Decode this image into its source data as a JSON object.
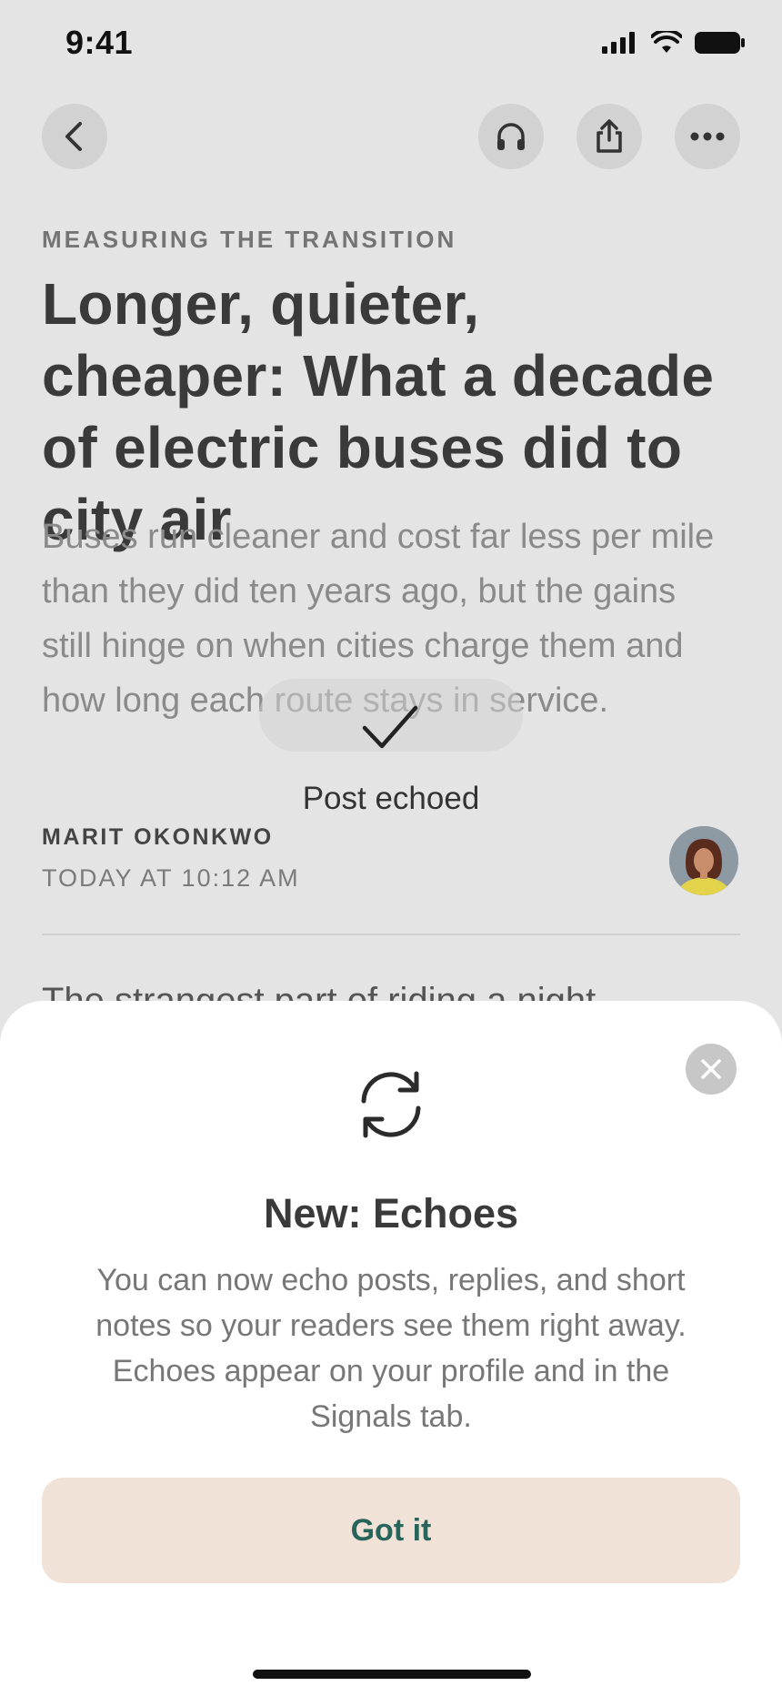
{
  "status_bar": {
    "time": "9:41"
  },
  "top_bar": {
    "back": "back-icon",
    "listen": "headphones-icon",
    "share": "share-icon",
    "more": "more-icon"
  },
  "article": {
    "kicker": "MEASURING THE TRANSITION",
    "headline": "Longer, quieter, cheaper: What a decade of electric buses did to city air",
    "dek": "Buses run cleaner and cost far less per mile than they did ten years ago, but the gains still hinge on when cities charge them and how long each route stays in service.",
    "author": "MARIT OKONKWO",
    "date": "TODAY AT 10:12 AM",
    "body_preview": "The strangest part of riding a night"
  },
  "toast": {
    "label": "Post echoed",
    "icon": "checkmark-icon"
  },
  "sheet": {
    "icon": "refresh-icon",
    "title": "New: Echoes",
    "text": "You can now echo posts, replies, and short notes so your readers see them right away. Echoes appear on your profile and in the Signals tab.",
    "button_label": "Got it",
    "close_icon": "close-icon"
  },
  "colors": {
    "button_bg": "#f0e2d7",
    "button_text": "#27655a",
    "page_bg": "#e4e4e4"
  }
}
